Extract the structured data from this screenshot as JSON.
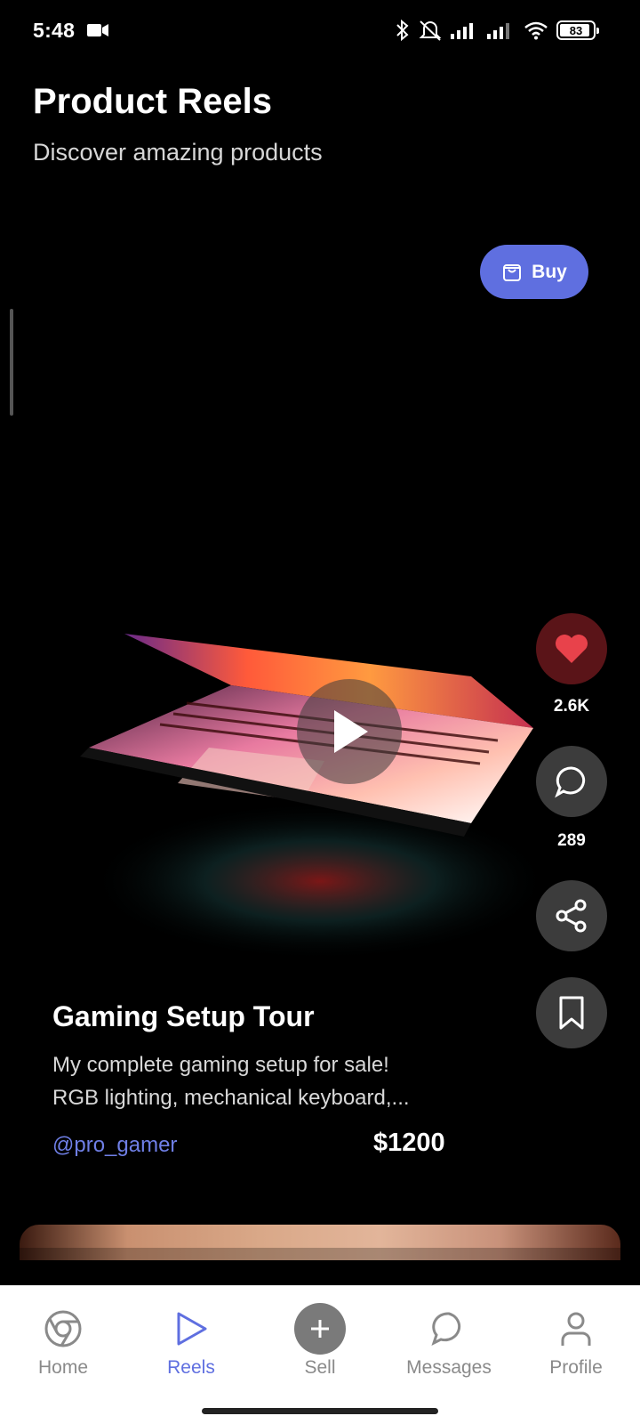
{
  "status_bar": {
    "time": "5:48",
    "battery": "83"
  },
  "header": {
    "title": "Product Reels",
    "subtitle": "Discover amazing products"
  },
  "reel": {
    "buy_label": "Buy",
    "title": "Gaming Setup Tour",
    "description_line1": "My complete gaming setup for sale!",
    "description_line2": "RGB lighting, mechanical keyboard,...",
    "username": "@pro_gamer",
    "price": "$1200",
    "likes": "2.6K",
    "comments": "289"
  },
  "nav": {
    "items": [
      {
        "label": "Home",
        "icon": "chrome-icon"
      },
      {
        "label": "Reels",
        "icon": "play-icon"
      },
      {
        "label": "Sell",
        "icon": "plus-icon"
      },
      {
        "label": "Messages",
        "icon": "message-icon"
      },
      {
        "label": "Profile",
        "icon": "profile-icon"
      }
    ],
    "active": "Reels"
  },
  "colors": {
    "accent": "#5f6fe0",
    "like": "#e8424b",
    "background": "#000000"
  }
}
